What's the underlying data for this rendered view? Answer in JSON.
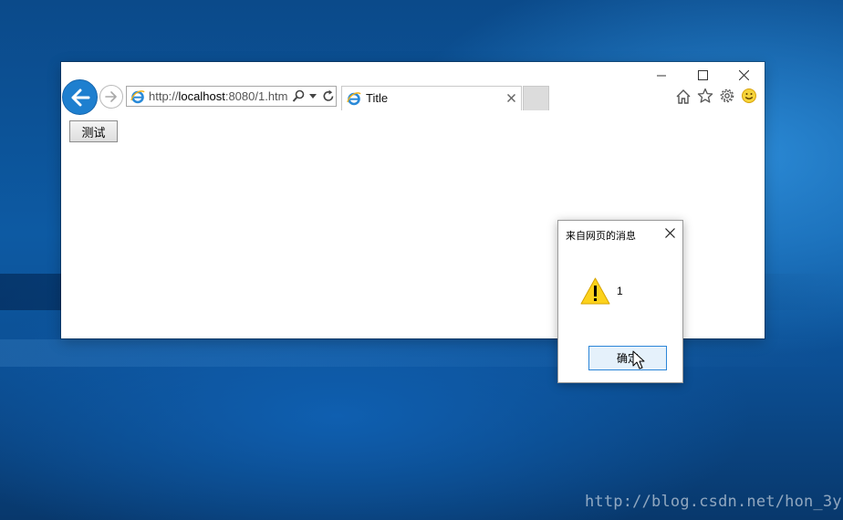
{
  "browser": {
    "address": {
      "prefix": "http://",
      "host": "localhost",
      "rest": ":8080/1.htm"
    },
    "tab": {
      "title": "Title"
    },
    "colors": {
      "accent": "#1e7fcf",
      "tab_inactive": "#dcdcdc"
    },
    "toolbar_icons": [
      "home-icon",
      "favorites-star-icon",
      "settings-gear-icon",
      "feedback-smiley-icon"
    ]
  },
  "page": {
    "test_button": "测试"
  },
  "alert": {
    "title": "来自网页的消息",
    "message": "1",
    "ok_label": "确定"
  },
  "watermark": "http://blog.csdn.net/hon_3y"
}
